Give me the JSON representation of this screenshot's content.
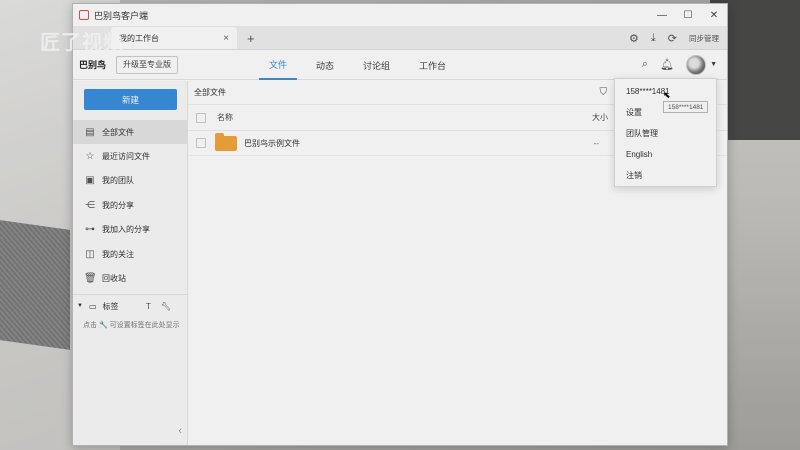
{
  "window": {
    "title": "巴别鸟客户端"
  },
  "watermark": {
    "text": "匠了视频"
  },
  "tabbar": {
    "active_tab": "我的工作台",
    "sync_label": "同步管理"
  },
  "navbar": {
    "brand": "巴别鸟",
    "upgrade_label": "升级至专业版",
    "tabs": [
      {
        "label": "文件"
      },
      {
        "label": "动态"
      },
      {
        "label": "讨论组"
      },
      {
        "label": "工作台"
      }
    ]
  },
  "sidebar": {
    "new_label": "新建",
    "items": [
      {
        "label": "全部文件",
        "icon": "all-files-icon"
      },
      {
        "label": "最近访问文件",
        "icon": "star-icon"
      },
      {
        "label": "我的团队",
        "icon": "team-icon"
      },
      {
        "label": "我的分享",
        "icon": "share-icon"
      },
      {
        "label": "我加入的分享",
        "icon": "joined-share-icon"
      },
      {
        "label": "我的关注",
        "icon": "follow-icon"
      },
      {
        "label": "回收站",
        "icon": "trash-icon"
      }
    ],
    "tags_label": "标签",
    "tags_hint": "点击 🔧 可设置标签在此处显示"
  },
  "main": {
    "breadcrumb": "全部文件",
    "columns": {
      "name": "名称",
      "size": "大小"
    },
    "rows": [
      {
        "name": "巴别鸟示例文件",
        "size": "--"
      }
    ]
  },
  "dropdown": {
    "items": [
      {
        "label": "158****1481"
      },
      {
        "label": "设置"
      },
      {
        "label": "团队管理"
      },
      {
        "label": "English"
      },
      {
        "label": "注销"
      }
    ],
    "tooltip": "158****1481"
  },
  "colors": {
    "accent": "#3b8fe0",
    "folder": "#f4a63a"
  }
}
